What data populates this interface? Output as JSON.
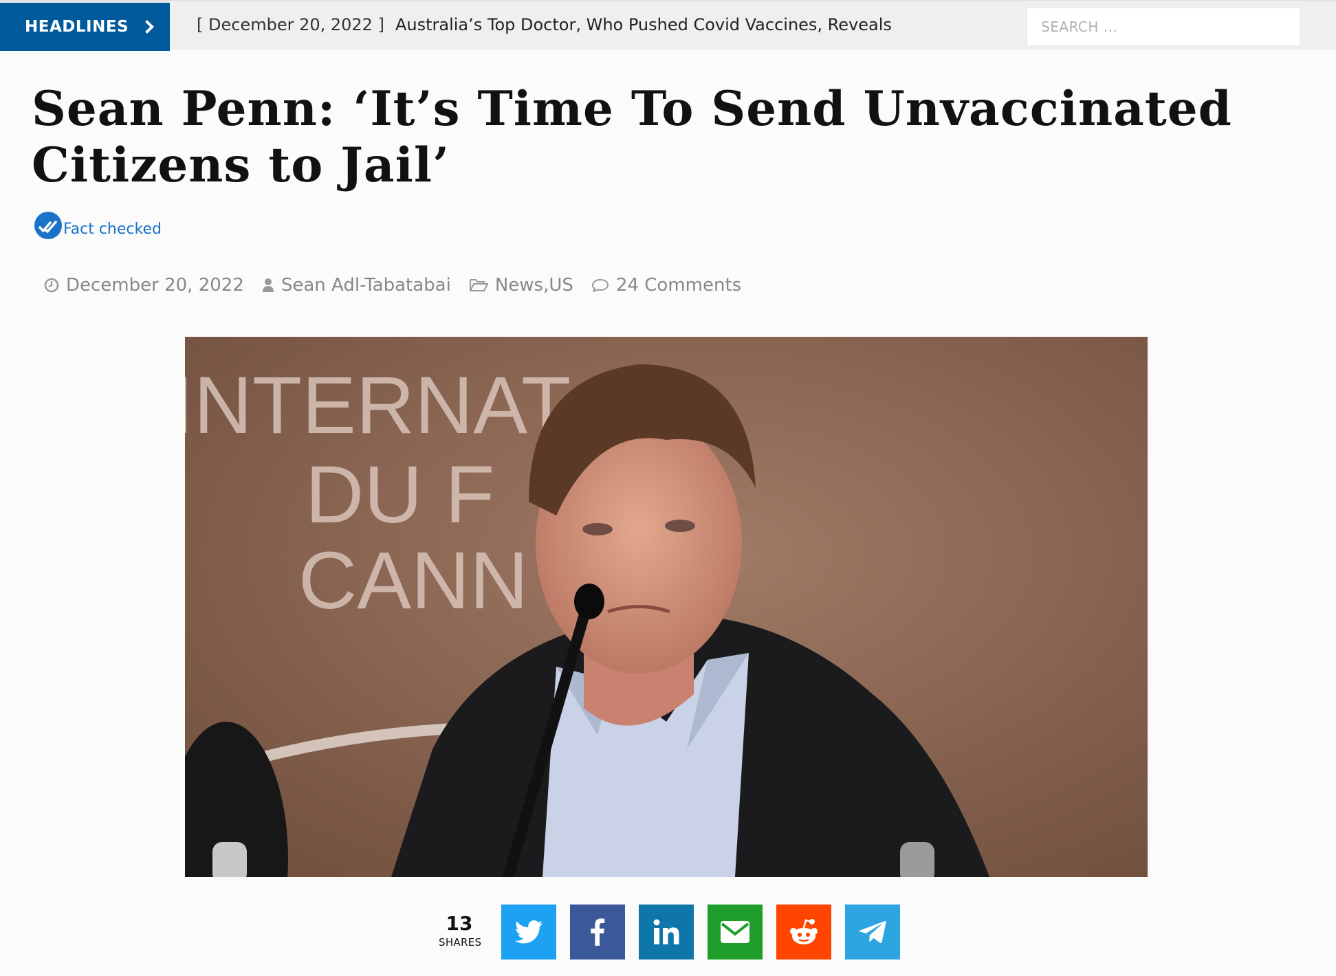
{
  "topbar": {
    "headlines_label": "HEADLINES",
    "ticker_date": "[ December 20, 2022 ]",
    "ticker_text": "Australia’s Top Doctor, Who Pushed Covid Vaccines, Reveals",
    "search_placeholder": "SEARCH ..."
  },
  "article": {
    "title": "Sean Penn: ‘It’s Time To Send Unvaccinated Citizens to Jail’",
    "fact_checked": "Fact checked",
    "date": "December 20, 2022",
    "author": "Sean Adl-Tabatabai",
    "categories": [
      "News",
      "US"
    ],
    "category_separator": ", ",
    "comments": "24 Comments"
  },
  "image": {
    "backdrop_text": [
      "INTERNAT",
      "DU F",
      "CANN"
    ]
  },
  "share": {
    "count": "13",
    "label": "SHARES",
    "buttons": [
      {
        "name": "twitter",
        "icon": "twitter-icon",
        "color": "#1da1f2"
      },
      {
        "name": "facebook",
        "icon": "facebook-icon",
        "color": "#3b5998"
      },
      {
        "name": "linkedin",
        "icon": "linkedin-icon",
        "color": "#0e76a8"
      },
      {
        "name": "email",
        "icon": "envelope-icon",
        "color": "#1f9d2b"
      },
      {
        "name": "reddit",
        "icon": "reddit-icon",
        "color": "#ff4500"
      },
      {
        "name": "telegram",
        "icon": "telegram-icon",
        "color": "#2ca5e0"
      }
    ]
  },
  "colors": {
    "brand": "#005a9c",
    "fact_check": "#1a73c9",
    "meta": "#888888"
  }
}
